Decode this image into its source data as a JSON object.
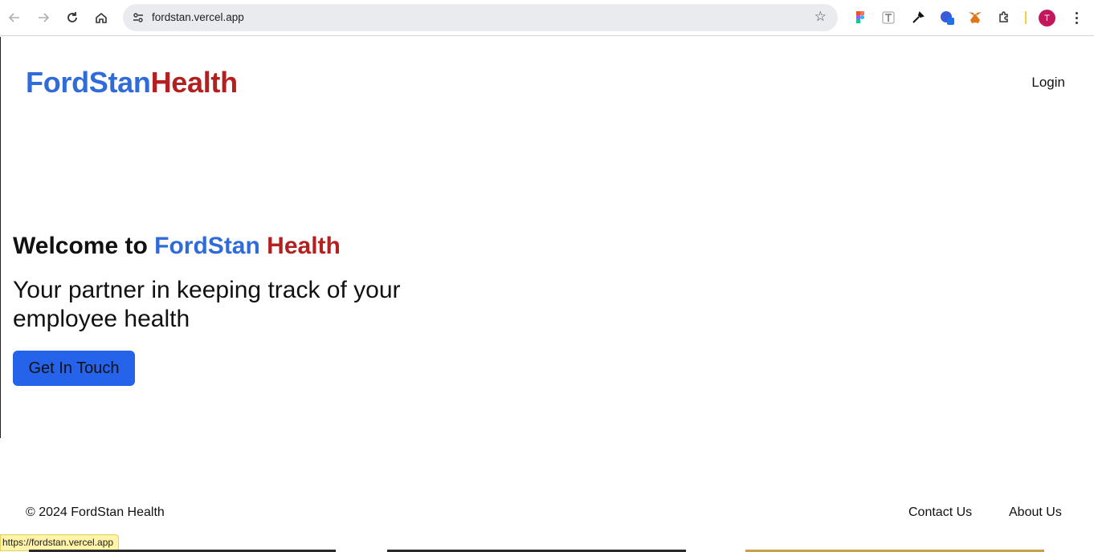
{
  "browser": {
    "url": "fordstan.vercel.app",
    "profile_initial": "T",
    "status_url": "https://fordstan.vercel.app",
    "icons": [
      "back-icon",
      "forward-icon",
      "reload-icon",
      "home-icon",
      "site-settings-icon",
      "bookmark-star-icon",
      "extension-icon",
      "kebab-menu-icon"
    ]
  },
  "header": {
    "logo_part1": "FordStan",
    "logo_part2": "Health",
    "login_label": "Login"
  },
  "hero": {
    "welcome_prefix": "Welcome to ",
    "welcome_brand1": "FordStan",
    "welcome_brand2": "Health",
    "tagline": "Your partner in keeping track of your employee health",
    "cta_label": "Get In Touch"
  },
  "footer": {
    "copyright": "© 2024 FordStan Health",
    "contact_label": "Contact Us",
    "about_label": "About Us"
  },
  "colors": {
    "brand_blue": "#2f6bd9",
    "brand_red": "#b41f1f",
    "button_blue": "#2563eb"
  }
}
